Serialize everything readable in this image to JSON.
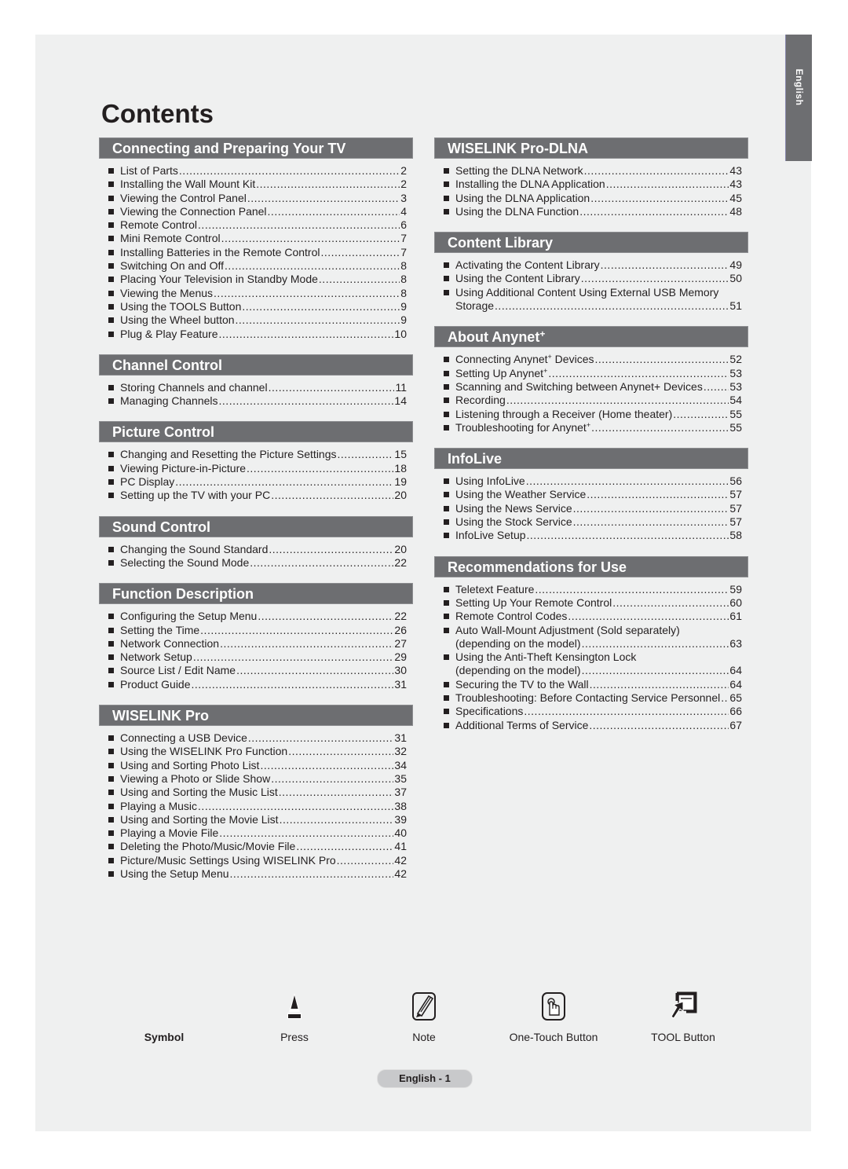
{
  "side_tab": {
    "label": "English"
  },
  "title": "Contents",
  "left_sections": [
    {
      "heading": "Connecting and Preparing Your TV",
      "items": [
        {
          "label": "List of Parts",
          "page": "2"
        },
        {
          "label": "Installing the Wall Mount Kit",
          "page": "2"
        },
        {
          "label": "Viewing the Control Panel",
          "page": "3"
        },
        {
          "label": "Viewing the Connection Panel",
          "page": "4"
        },
        {
          "label": "Remote Control",
          "page": "6"
        },
        {
          "label": "Mini Remote Control",
          "page": "7"
        },
        {
          "label": "Installing Batteries in the Remote Control",
          "page": "7"
        },
        {
          "label": "Switching On and Off",
          "page": "8"
        },
        {
          "label": "Placing Your Television in Standby Mode",
          "page": "8"
        },
        {
          "label": "Viewing the Menus",
          "page": "8"
        },
        {
          "label": "Using the TOOLS Button",
          "page": "9"
        },
        {
          "label": "Using the Wheel button",
          "page": "9"
        },
        {
          "label": "Plug & Play Feature",
          "page": "10"
        }
      ]
    },
    {
      "heading": "Channel Control",
      "items": [
        {
          "label": "Storing Channels and channel",
          "page": "11"
        },
        {
          "label": "Managing Channels",
          "page": "14"
        }
      ]
    },
    {
      "heading": "Picture Control",
      "items": [
        {
          "label": "Changing and Resetting the Picture Settings",
          "page": "15"
        },
        {
          "label": "Viewing Picture-in-Picture",
          "page": "18"
        },
        {
          "label": "PC Display",
          "page": "19"
        },
        {
          "label": "Setting up the TV with your PC",
          "page": "20"
        }
      ]
    },
    {
      "heading": "Sound Control",
      "items": [
        {
          "label": "Changing the Sound Standard",
          "page": "20"
        },
        {
          "label": "Selecting the Sound Mode",
          "page": "22"
        }
      ]
    },
    {
      "heading": "Function Description",
      "items": [
        {
          "label": "Configuring the Setup Menu",
          "page": "22"
        },
        {
          "label": "Setting the Time",
          "page": "26"
        },
        {
          "label": "Network Connection",
          "page": "27"
        },
        {
          "label": "Network Setup",
          "page": "29"
        },
        {
          "label": "Source List / Edit Name",
          "page": "30"
        },
        {
          "label": "Product Guide",
          "page": "31"
        }
      ]
    },
    {
      "heading": "WISELINK Pro",
      "items": [
        {
          "label": "Connecting a USB Device",
          "page": "31"
        },
        {
          "label": "Using the WISELINK Pro Function",
          "page": "32"
        },
        {
          "label": "Using and Sorting Photo List",
          "page": "34"
        },
        {
          "label": "Viewing a Photo or Slide Show",
          "page": "35"
        },
        {
          "label": "Using and Sorting the Music List",
          "page": "37"
        },
        {
          "label": "Playing a Music",
          "page": "38"
        },
        {
          "label": "Using and Sorting the Movie List",
          "page": "39"
        },
        {
          "label": "Playing a Movie File",
          "page": "40"
        },
        {
          "label": "Deleting the Photo/Music/Movie File",
          "page": "41"
        },
        {
          "label": "Picture/Music Settings Using WISELINK Pro",
          "page": "42"
        },
        {
          "label": "Using the Setup Menu",
          "page": "42"
        }
      ]
    }
  ],
  "right_sections": [
    {
      "heading": "WISELINK Pro-DLNA",
      "items": [
        {
          "label": "Setting the DLNA Network",
          "page": "43"
        },
        {
          "label": "Installing the DLNA Application",
          "page": "43"
        },
        {
          "label": "Using the DLNA Application",
          "page": "45"
        },
        {
          "label": "Using the DLNA Function",
          "page": "48"
        }
      ]
    },
    {
      "heading": "Content Library",
      "items": [
        {
          "label": "Activating the Content Library",
          "page": "49"
        },
        {
          "label": "Using the Content Library",
          "page": "50"
        },
        {
          "label": "Using Additional Content Using External USB Memory",
          "label2": "Storage",
          "page": "51"
        }
      ]
    },
    {
      "heading": "About Anynet",
      "heading_sup": "+",
      "items": [
        {
          "label": "Connecting Anynet",
          "sup": "+",
          "label_after": " Devices",
          "page": "52"
        },
        {
          "label": "Setting Up Anynet",
          "sup": "+",
          "page": "53"
        },
        {
          "label": "Scanning and Switching between Anynet+ Devices",
          "page": "53"
        },
        {
          "label": "Recording",
          "page": "54"
        },
        {
          "label": "Listening through a Receiver (Home theater)",
          "page": "55"
        },
        {
          "label": "Troubleshooting for Anynet",
          "sup": "+",
          "page": "55"
        }
      ]
    },
    {
      "heading": "InfoLive",
      "items": [
        {
          "label": "Using InfoLive",
          "page": "56"
        },
        {
          "label": "Using the Weather Service",
          "page": "57"
        },
        {
          "label": "Using the News Service",
          "page": "57"
        },
        {
          "label": "Using the Stock Service",
          "page": "57"
        },
        {
          "label": "InfoLive Setup",
          "page": "58"
        }
      ]
    },
    {
      "heading": "Recommendations for Use",
      "items": [
        {
          "label": "Teletext Feature",
          "page": "59"
        },
        {
          "label": "Setting Up Your Remote Control",
          "page": "60"
        },
        {
          "label": "Remote Control Codes",
          "page": "61"
        },
        {
          "label": "Auto Wall-Mount Adjustment (Sold separately)",
          "label2": "(depending on the model)",
          "page": "63"
        },
        {
          "label": "Using the Anti-Theft Kensington Lock",
          "label2": "(depending on the model)",
          "page": "64"
        },
        {
          "label": "Securing the TV to the Wall",
          "page": "64"
        },
        {
          "label": "Troubleshooting: Before Contacting Service Personnel",
          "page": "65"
        },
        {
          "label": "Specifications",
          "page": "66"
        },
        {
          "label": "Additional Terms of Service",
          "page": "67"
        }
      ]
    }
  ],
  "symbols": {
    "heading": "Symbol",
    "items": [
      {
        "icon": "press-icon",
        "label": "Press"
      },
      {
        "icon": "note-icon",
        "label": "Note"
      },
      {
        "icon": "one-touch-button-icon",
        "label": "One-Touch Button"
      },
      {
        "icon": "tool-button-icon",
        "label": "TOOL Button"
      }
    ]
  },
  "footer": {
    "page_label": "English - 1"
  }
}
